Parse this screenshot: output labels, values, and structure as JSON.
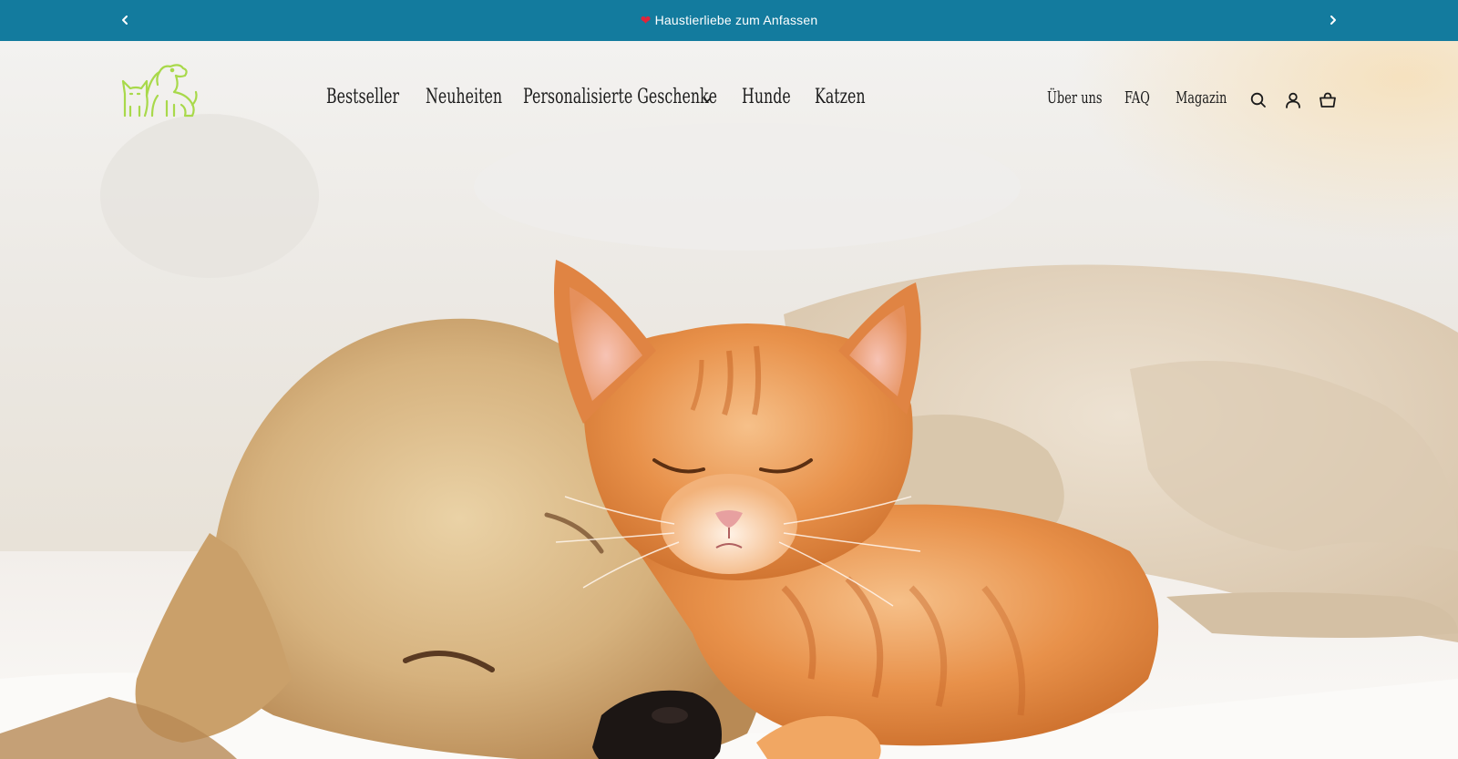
{
  "announcement": {
    "text": "Haustierliebe zum Anfassen",
    "heart_icon": "heart-icon",
    "background_color": "#137b9e",
    "text_color": "#ffffff"
  },
  "header": {
    "logo_icon": "dog-and-cat-logo-icon",
    "logo_color": "#a8d94a",
    "nav_main": [
      {
        "label": "Bestseller"
      },
      {
        "label": "Neuheiten"
      },
      {
        "label": "Personalisierte Geschenke",
        "has_dropdown": true
      },
      {
        "label": "Hunde"
      },
      {
        "label": "Katzen"
      }
    ],
    "nav_secondary": [
      {
        "label": "Über uns"
      },
      {
        "label": "FAQ"
      },
      {
        "label": "Magazin"
      }
    ],
    "icons": [
      "search-icon",
      "account-icon",
      "cart-icon"
    ]
  },
  "hero": {
    "image": "sleeping puppy and kitten on a rug"
  }
}
